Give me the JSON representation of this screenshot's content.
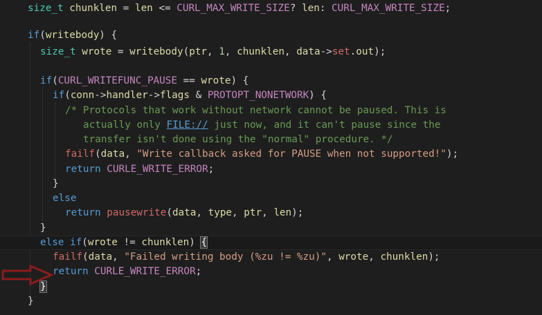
{
  "colors": {
    "background": "#1e1e1e",
    "keyword": "#569cd6",
    "type": "#4ec9b0",
    "identifier": "#dcdcaa",
    "macro": "#c586c0",
    "function": "#d16969",
    "string": "#d69d85",
    "comment": "#6a9955",
    "arrow": "#8b1c1c"
  },
  "code_lines": [
    {
      "tokens": [
        [
          "type",
          "size_t"
        ],
        [
          "plain",
          " "
        ],
        [
          "id",
          "chunklen"
        ],
        [
          "plain",
          " = "
        ],
        [
          "id",
          "len"
        ],
        [
          "plain",
          " <= "
        ],
        [
          "macro",
          "CURL_MAX_WRITE_SIZE"
        ],
        [
          "plain",
          "? "
        ],
        [
          "id",
          "len"
        ],
        [
          "plain",
          ": "
        ],
        [
          "macro",
          "CURL_MAX_WRITE_SIZE"
        ],
        [
          "plain",
          ";"
        ]
      ]
    },
    {
      "tokens": []
    },
    {
      "tokens": [
        [
          "kw",
          "if"
        ],
        [
          "plain",
          "("
        ],
        [
          "id",
          "writebody"
        ],
        [
          "plain",
          ") {"
        ]
      ]
    },
    {
      "tokens": [
        [
          "type",
          "size_t"
        ],
        [
          "plain",
          " "
        ],
        [
          "id",
          "wrote"
        ],
        [
          "plain",
          " = "
        ],
        [
          "id",
          "writebody"
        ],
        [
          "plain",
          "("
        ],
        [
          "id",
          "ptr"
        ],
        [
          "plain",
          ", "
        ],
        [
          "num",
          "1"
        ],
        [
          "plain",
          ", "
        ],
        [
          "id",
          "chunklen"
        ],
        [
          "plain",
          ", "
        ],
        [
          "id",
          "data"
        ],
        [
          "plain",
          "->"
        ],
        [
          "func",
          "set"
        ],
        [
          "plain",
          "."
        ],
        [
          "id",
          "out"
        ],
        [
          "plain",
          ");"
        ]
      ]
    },
    {
      "tokens": []
    },
    {
      "tokens": [
        [
          "kw",
          "if"
        ],
        [
          "plain",
          "("
        ],
        [
          "macro",
          "CURL_WRITEFUNC_PAUSE"
        ],
        [
          "plain",
          " == "
        ],
        [
          "id",
          "wrote"
        ],
        [
          "plain",
          ") {"
        ]
      ]
    },
    {
      "tokens": [
        [
          "kw",
          "if"
        ],
        [
          "plain",
          "("
        ],
        [
          "id",
          "conn"
        ],
        [
          "plain",
          "->"
        ],
        [
          "id",
          "handler"
        ],
        [
          "plain",
          "->"
        ],
        [
          "id",
          "flags"
        ],
        [
          "plain",
          " & "
        ],
        [
          "macro",
          "PROTOPT_NONETWORK"
        ],
        [
          "plain",
          ") {"
        ]
      ]
    },
    {
      "tokens": [
        [
          "comment",
          "/* Protocols that work without network cannot be paused. This is"
        ]
      ]
    },
    {
      "tokens": [
        [
          "comment",
          "actually only "
        ],
        [
          "link",
          "FILE://"
        ],
        [
          "comment",
          " just now, and it can't pause since the"
        ]
      ]
    },
    {
      "tokens": [
        [
          "comment",
          "transfer isn't done using the \"normal\" procedure. */"
        ]
      ]
    },
    {
      "tokens": [
        [
          "func",
          "failf"
        ],
        [
          "plain",
          "("
        ],
        [
          "id",
          "data"
        ],
        [
          "plain",
          ", "
        ],
        [
          "str",
          "\"Write callback asked for PAUSE when not supported!\""
        ],
        [
          "plain",
          ");"
        ]
      ]
    },
    {
      "tokens": [
        [
          "kw",
          "return"
        ],
        [
          "plain",
          " "
        ],
        [
          "macro",
          "CURLE_WRITE_ERROR"
        ],
        [
          "plain",
          ";"
        ]
      ]
    },
    {
      "tokens": [
        [
          "plain",
          "}"
        ]
      ]
    },
    {
      "tokens": [
        [
          "kw",
          "else"
        ]
      ]
    },
    {
      "tokens": [
        [
          "kw",
          "return"
        ],
        [
          "plain",
          " "
        ],
        [
          "func",
          "pausewrite"
        ],
        [
          "plain",
          "("
        ],
        [
          "id",
          "data"
        ],
        [
          "plain",
          ", "
        ],
        [
          "id",
          "type"
        ],
        [
          "plain",
          ", "
        ],
        [
          "id",
          "ptr"
        ],
        [
          "plain",
          ", "
        ],
        [
          "id",
          "len"
        ],
        [
          "plain",
          ");"
        ]
      ]
    },
    {
      "tokens": [
        [
          "plain",
          "}"
        ]
      ]
    },
    {
      "tokens": [
        [
          "kw",
          "else"
        ],
        [
          "plain",
          " "
        ],
        [
          "kw",
          "if"
        ],
        [
          "plain",
          "("
        ],
        [
          "id",
          "wrote"
        ],
        [
          "plain",
          " != "
        ],
        [
          "id",
          "chunklen"
        ],
        [
          "plain",
          ") "
        ],
        [
          "brace",
          "{"
        ]
      ]
    },
    {
      "tokens": [
        [
          "func",
          "failf"
        ],
        [
          "plain",
          "("
        ],
        [
          "id",
          "data"
        ],
        [
          "plain",
          ", "
        ],
        [
          "str",
          "\"Failed writing body (%zu != %zu)\""
        ],
        [
          "plain",
          ", "
        ],
        [
          "id",
          "wrote"
        ],
        [
          "plain",
          ", "
        ],
        [
          "id",
          "chunklen"
        ],
        [
          "plain",
          ");"
        ]
      ]
    },
    {
      "tokens": [
        [
          "kw",
          "return"
        ],
        [
          "plain",
          " "
        ],
        [
          "macro",
          "CURLE_WRITE_ERROR"
        ],
        [
          "plain",
          ";"
        ]
      ]
    },
    {
      "tokens": [
        [
          "brace",
          "}"
        ]
      ]
    },
    {
      "tokens": [
        [
          "plain",
          "}"
        ]
      ]
    }
  ]
}
